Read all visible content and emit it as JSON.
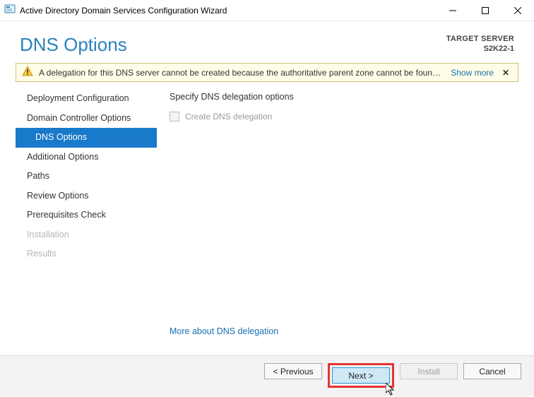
{
  "window": {
    "title": "Active Directory Domain Services Configuration Wizard"
  },
  "header": {
    "page_title": "DNS Options",
    "target_label": "TARGET SERVER",
    "target_name": "S2K22-1"
  },
  "warning": {
    "message": "A delegation for this DNS server cannot be created because the authoritative parent zone cannot be found...",
    "show_more": "Show more",
    "close": "✕"
  },
  "sidebar": {
    "items": [
      {
        "label": "Deployment Configuration",
        "state": "normal"
      },
      {
        "label": "Domain Controller Options",
        "state": "normal"
      },
      {
        "label": "DNS Options",
        "state": "selected"
      },
      {
        "label": "Additional Options",
        "state": "normal"
      },
      {
        "label": "Paths",
        "state": "normal"
      },
      {
        "label": "Review Options",
        "state": "normal"
      },
      {
        "label": "Prerequisites Check",
        "state": "normal"
      },
      {
        "label": "Installation",
        "state": "disabled"
      },
      {
        "label": "Results",
        "state": "disabled"
      }
    ]
  },
  "content": {
    "heading": "Specify DNS delegation options",
    "checkbox_label": "Create DNS delegation",
    "more_link": "More about DNS delegation"
  },
  "footer": {
    "previous": "< Previous",
    "next": "Next >",
    "install": "Install",
    "cancel": "Cancel"
  }
}
